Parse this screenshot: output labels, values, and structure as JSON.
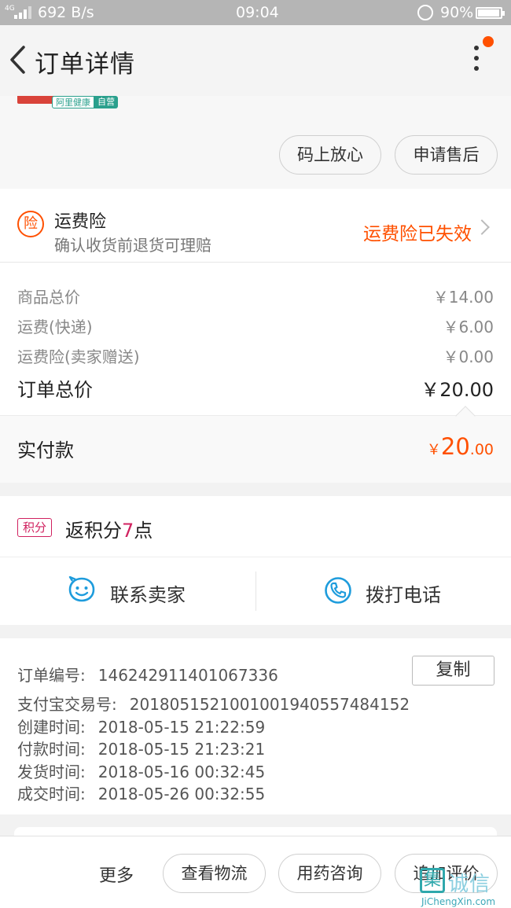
{
  "status_bar": {
    "network": "4G",
    "speed": "692 B/s",
    "time": "09:04",
    "battery": "90%"
  },
  "header": {
    "title": "订单详情"
  },
  "product": {
    "badge_brand": "阿里健康",
    "badge_self": "自营",
    "actions": [
      "码上放心",
      "申请售后"
    ]
  },
  "insurance": {
    "icon_char": "险",
    "title": "运费险",
    "subtitle": "确认收货前退货可理赔",
    "status": "运费险已失效"
  },
  "prices": {
    "goods_label": "商品总价",
    "goods_value": "￥14.00",
    "shipping_label": "运费(快递)",
    "shipping_value": "￥6.00",
    "insurance_label": "运费险(卖家赠送)",
    "insurance_value": "￥0.00",
    "total_label": "订单总价",
    "total_value": "￥20.00"
  },
  "paid": {
    "label": "实付款",
    "currency": "￥",
    "integer": "20",
    "decimal": ".00"
  },
  "points": {
    "tag": "积分",
    "text_before": "返积分",
    "number": "7",
    "text_after": "点"
  },
  "contact": {
    "seller": "联系卖家",
    "phone": "拨打电话"
  },
  "order_info": {
    "copy_label": "复制",
    "lines": [
      {
        "label": "订单编号:",
        "value": "146242911401067336"
      },
      {
        "label": "支付宝交易号:",
        "value": "2018051521001001940557484152"
      },
      {
        "label": "创建时间:",
        "value": "2018-05-15 21:22:59"
      },
      {
        "label": "付款时间:",
        "value": "2018-05-15 21:23:21"
      },
      {
        "label": "发货时间:",
        "value": "2018-05-16 00:32:45"
      },
      {
        "label": "成交时间:",
        "value": "2018-05-26 00:32:55"
      }
    ]
  },
  "bottom_bar": {
    "more": "更多",
    "buttons": [
      "查看物流",
      "用药咨询",
      "追加评价"
    ]
  },
  "watermark": {
    "cn": "诚信",
    "en": "JiChengXin.com"
  },
  "colors": {
    "accent": "#ff5000",
    "points": "#d0215f",
    "contact_icon": "#1e9cdc"
  }
}
